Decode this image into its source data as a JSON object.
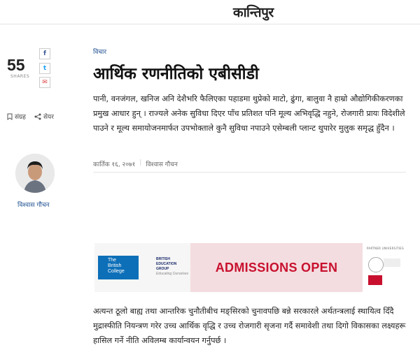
{
  "site": {
    "logo": "कान्तिपुर"
  },
  "share": {
    "count": "55",
    "label": "SHARES",
    "facebook_icon": "f",
    "twitter_icon": "t",
    "email_icon": "✉"
  },
  "actions": {
    "save_label": "संग्रह",
    "share_label": "सेयर"
  },
  "article": {
    "category": "विचार",
    "title": "आर्थिक रणनीतिको एबीसीडी",
    "summary": "पानी, वनजंगल, खनिज अनि देशैभरि फैलिएका पहाडमा थुप्रेको माटो, ढुंगा, बालुवा नै हाम्रो औद्योगिकीकरणका प्रमुख आधार हुन् । राज्यले अनेक सुविधा दिएर पाँच प्रतिशत पनि मूल्य अभिवृद्धि नहुने, रोजगारी प्रायः विदेशीले पाउने र मूल्य समायोजनमार्फत उपभोक्ताले कुनै सुविधा नपाउने एसेम्बली प्लान्ट थुपारेर मुलुक समृद्ध हुँदैन ।",
    "date": "कार्तिक १६, २०७१",
    "author": "विश्वास गौचन",
    "body_first": "अत्यन्त ठूलो बाह्य तथा आन्तरिक चुनौतीबीच मङ्सिरको चुनावपछि बन्ने सरकारले अर्थतन्त्रलाई स्थायित्व दिँदै मुद्रास्फीति नियन्त्रण गरेर उच्च आर्थिक वृद्धि र उच्च रोजगारी सृजना गर्दै समावेशी तथा दिगो विकासका लक्ष्यहरू हासिल गर्ने नीति अविलम्ब कार्यान्वयन गर्नुपर्छ ।"
  },
  "author_box": {
    "name": "विश्वास गौचन"
  },
  "ad": {
    "college_line1": "The",
    "college_line2": "British",
    "college_line3": "College",
    "group_line1": "BRITISH",
    "group_line2": "EDUCATION",
    "group_line3": "GROUP",
    "group_tag": "Educating Ourselves",
    "headline": "ADMISSIONS OPEN",
    "partner_label": "PARTNER UNIVERSITIES"
  },
  "colors": {
    "link": "#1a4d8f",
    "ad_red": "#c8102e",
    "ad_blue": "#0d6fb8"
  }
}
